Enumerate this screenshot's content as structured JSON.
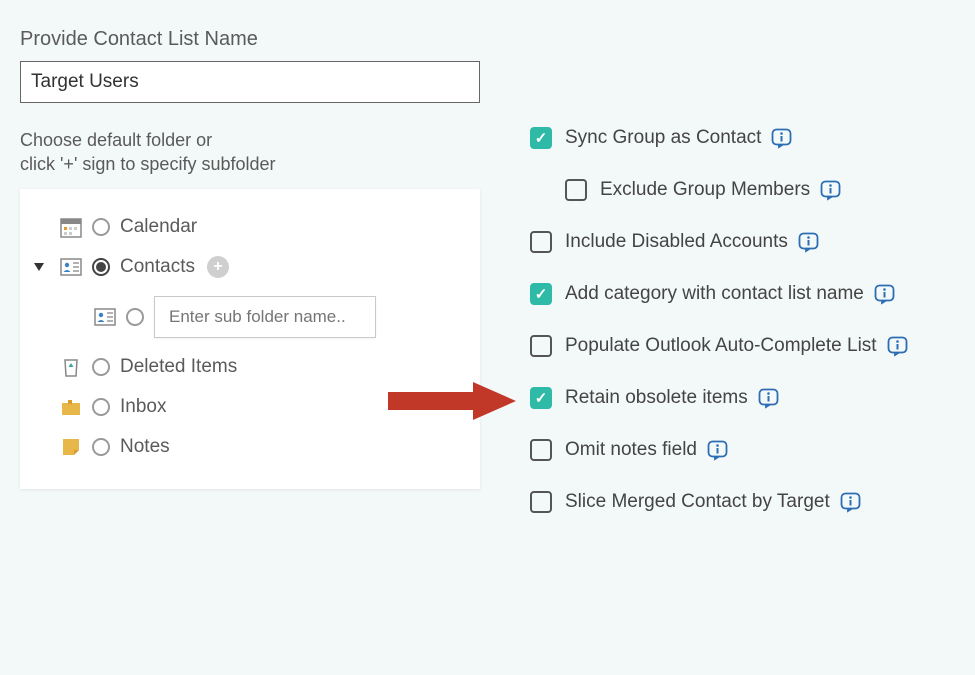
{
  "contact_list": {
    "title": "Provide Contact List Name",
    "value": "Target Users"
  },
  "folder_section": {
    "instruction_line1": "Choose default folder or",
    "instruction_line2": "click '+' sign to specify subfolder",
    "subfolder_placeholder": "Enter sub folder name..",
    "folders": {
      "calendar": "Calendar",
      "contacts": "Contacts",
      "deleted": "Deleted Items",
      "inbox": "Inbox",
      "notes": "Notes"
    }
  },
  "options": {
    "sync_group": {
      "label": "Sync Group as Contact",
      "checked": true
    },
    "exclude_members": {
      "label": "Exclude Group Members",
      "checked": false
    },
    "include_disabled": {
      "label": "Include Disabled Accounts",
      "checked": false
    },
    "add_category": {
      "label": "Add category with contact list name",
      "checked": true
    },
    "populate_autocomplete": {
      "label": "Populate Outlook Auto-Complete List",
      "checked": false
    },
    "retain_obsolete": {
      "label": "Retain obsolete items",
      "checked": true
    },
    "omit_notes": {
      "label": "Omit notes field",
      "checked": false
    },
    "slice_merged": {
      "label": "Slice Merged Contact by Target",
      "checked": false
    }
  }
}
